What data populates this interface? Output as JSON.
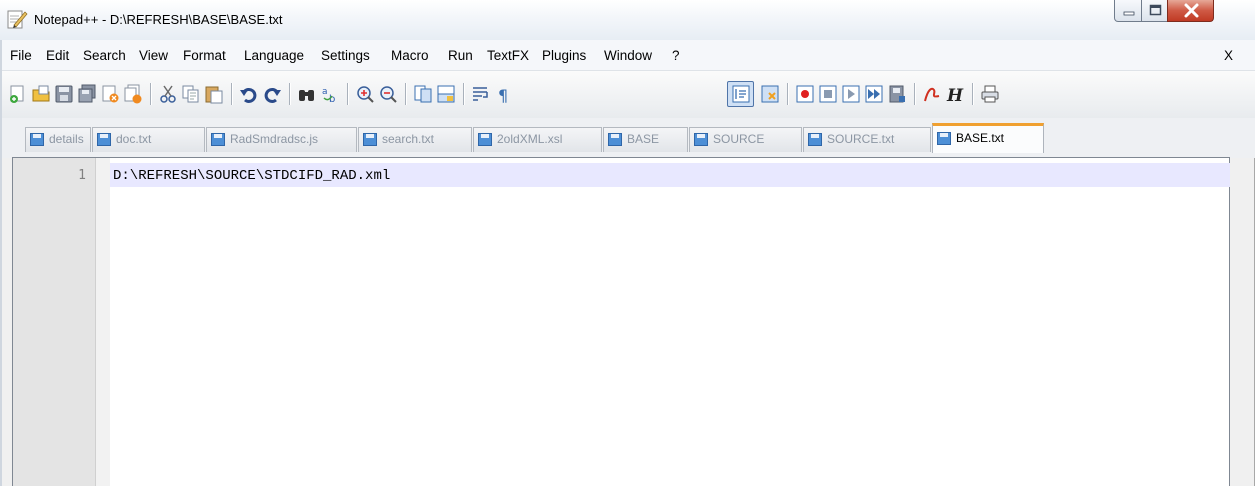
{
  "window": {
    "title": "Notepad++ - D:\\REFRESH\\BASE\\BASE.txt",
    "icon": "notepad-pencil-icon"
  },
  "menu": {
    "items": [
      "File",
      "Edit",
      "Search",
      "View",
      "Format",
      "Language",
      "Settings",
      "Macro",
      "Run",
      "TextFX",
      "Plugins",
      "Window",
      "?"
    ],
    "close_label": "X"
  },
  "toolbar": {
    "icons": [
      "new-file-icon",
      "open-file-icon",
      "save-icon",
      "save-all-icon",
      "close-icon",
      "close-all-icon",
      "cut-icon",
      "copy-icon",
      "paste-icon",
      "undo-icon",
      "redo-icon",
      "find-icon",
      "replace-icon",
      "zoom-in-icon",
      "zoom-out-icon",
      "sync-vertical-icon",
      "sync-horizontal-icon",
      "word-wrap-icon",
      "show-all-chars-icon",
      "indent-guide-icon",
      "doc-map-icon",
      "record-macro-icon",
      "stop-macro-icon",
      "play-macro-icon",
      "run-macro-multiple-icon",
      "save-macro-icon",
      "pdf-icon",
      "html-icon",
      "print-icon"
    ]
  },
  "tabs": [
    {
      "label": "details",
      "active": false
    },
    {
      "label": "doc.txt",
      "active": false
    },
    {
      "label": "RadSmdradsc.js",
      "active": false
    },
    {
      "label": "search.txt",
      "active": false
    },
    {
      "label": "2oldXML.xsl",
      "active": false
    },
    {
      "label": "BASE",
      "active": false
    },
    {
      "label": "SOURCE",
      "active": false
    },
    {
      "label": "SOURCE.txt",
      "active": false
    },
    {
      "label": "BASE.txt",
      "active": true
    }
  ],
  "editor": {
    "line_number": "1",
    "line_text": "D:\\REFRESH\\SOURCE\\STDCIFD_RAD.xml",
    "current_line_color": "#e8e8ff"
  },
  "colors": {
    "active_tab_accent": "#f0a030",
    "close_button": "#c03a24"
  }
}
